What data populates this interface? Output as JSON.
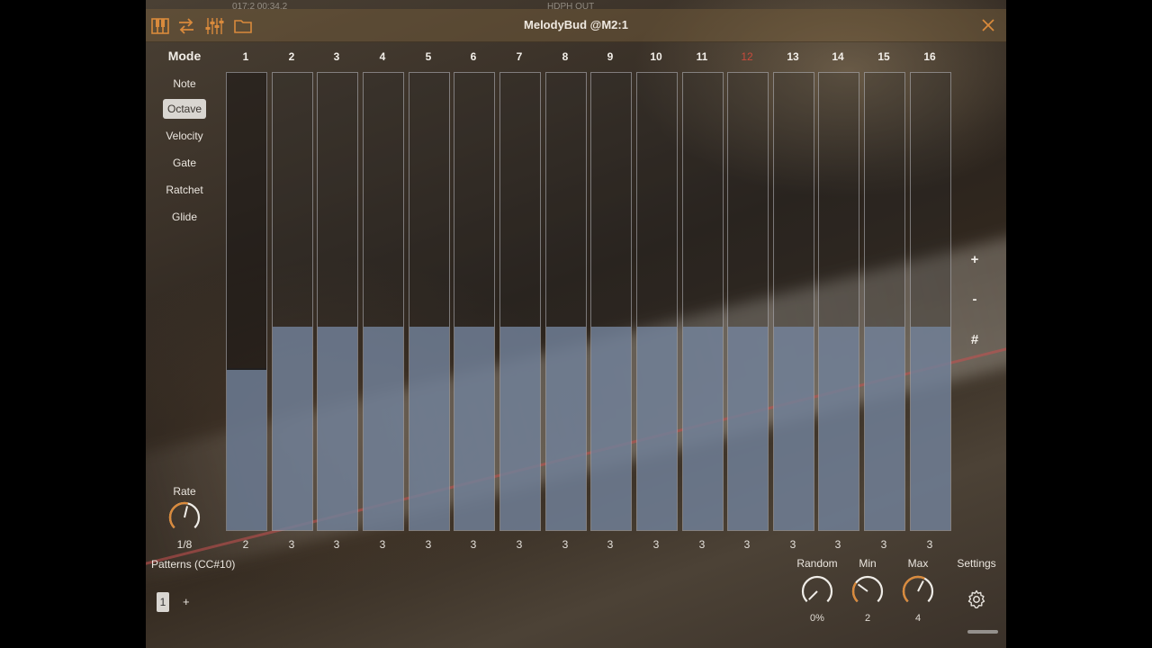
{
  "status_bar": {
    "left_text": "017:2  00:34.2",
    "right_text": "HDPH OUT"
  },
  "titlebar": {
    "title": "MelodyBud @M2:1",
    "icons": [
      "piano-keys-icon",
      "routing-arrows-icon",
      "mixer-sliders-icon",
      "folder-icon"
    ],
    "close_icon": "close-icon"
  },
  "colors": {
    "accent": "#d98a3c",
    "playing_step": "#c84b3c",
    "bar_fill": "#7687a0"
  },
  "mode": {
    "heading": "Mode",
    "items": [
      {
        "label": "Note",
        "active": false
      },
      {
        "label": "Octave",
        "active": true
      },
      {
        "label": "Velocity",
        "active": false
      },
      {
        "label": "Gate",
        "active": false
      },
      {
        "label": "Ratchet",
        "active": false
      },
      {
        "label": "Glide",
        "active": false
      }
    ]
  },
  "steps": {
    "headers": [
      "1",
      "2",
      "3",
      "4",
      "5",
      "6",
      "7",
      "8",
      "9",
      "10",
      "11",
      "12",
      "13",
      "14",
      "15",
      "16"
    ],
    "playing_index": 11,
    "values": [
      "2",
      "3",
      "3",
      "3",
      "3",
      "3",
      "3",
      "3",
      "3",
      "3",
      "3",
      "3",
      "3",
      "3",
      "3",
      "3"
    ],
    "fill_fraction": [
      0.35,
      0.445,
      0.445,
      0.445,
      0.445,
      0.445,
      0.445,
      0.445,
      0.445,
      0.445,
      0.445,
      0.445,
      0.445,
      0.445,
      0.445,
      0.445
    ]
  },
  "side_buttons": {
    "plus": "+",
    "minus": "-",
    "hash": "#"
  },
  "rate": {
    "label": "Rate",
    "value": "1/8",
    "knob_fraction": 0.55
  },
  "patterns": {
    "label": "Patterns (CC#10)",
    "selected": "1",
    "add": "+"
  },
  "knobs": [
    {
      "label": "Random",
      "value": "0%",
      "fraction": 0.0
    },
    {
      "label": "Min",
      "value": "2",
      "fraction": 0.3
    },
    {
      "label": "Max",
      "value": "4",
      "fraction": 0.6
    }
  ],
  "settings": {
    "label": "Settings",
    "icon": "gear-icon"
  }
}
